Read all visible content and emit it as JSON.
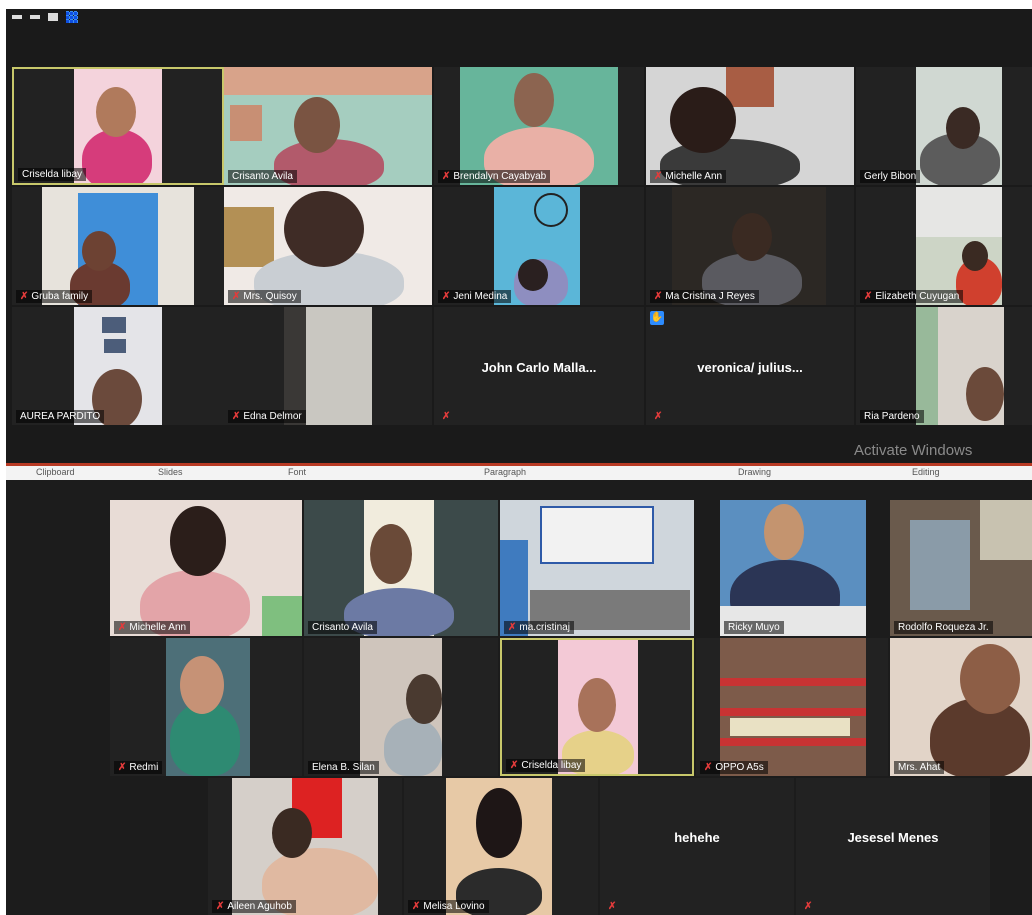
{
  "toolbar": {
    "icons": [
      "minimize-icon",
      "restore-icon",
      "speaker-view-icon",
      "gallery-view-icon"
    ]
  },
  "top_gallery": {
    "participants": [
      {
        "name": "Criselda libay",
        "muted": false,
        "active": true
      },
      {
        "name": "Crisanto Avila",
        "muted": false
      },
      {
        "name": "Brendalyn   Cayabyab",
        "muted": true
      },
      {
        "name": "Michelle Ann",
        "muted": true
      },
      {
        "name": "Gerly Bibon",
        "muted": false
      },
      {
        "name": "Gruba family",
        "muted": true
      },
      {
        "name": "Mrs. Quisoy",
        "muted": true
      },
      {
        "name": "Jeni Medina",
        "muted": true
      },
      {
        "name": "Ma Cristina J Reyes",
        "muted": true
      },
      {
        "name": "Elizabeth Cuyugan",
        "muted": true
      },
      {
        "name": "AUREA PARDITO",
        "muted": false
      },
      {
        "name": "Edna Delmor",
        "muted": true
      },
      {
        "name": "John Carlo Malla...",
        "muted": true,
        "video_off": true
      },
      {
        "name": "veronica/ julius...",
        "muted": true,
        "video_off": true,
        "hand_raised": true
      },
      {
        "name": "Ria Pardeno",
        "muted": false
      }
    ]
  },
  "ribbon": {
    "groups": [
      "Clipboard",
      "Slides",
      "Font",
      "Paragraph",
      "Drawing",
      "Editing"
    ]
  },
  "watermark": "Activate Windows",
  "bottom_gallery": {
    "participants": [
      {
        "name": "Michelle Ann",
        "muted": true
      },
      {
        "name": "Crisanto Avila",
        "muted": false
      },
      {
        "name": "ma.cristinaj",
        "muted": true
      },
      {
        "name": "Ricky Muyo",
        "muted": false
      },
      {
        "name": "Rodolfo Roqueza Jr.",
        "muted": false
      },
      {
        "name": "Redmi",
        "muted": true
      },
      {
        "name": "Elena B. Silan",
        "muted": false
      },
      {
        "name": "Criselda libay",
        "muted": true,
        "active": true
      },
      {
        "name": "OPPO A5s",
        "muted": true
      },
      {
        "name": "Mrs. Ahat",
        "muted": false
      },
      {
        "name": "Aileen Aguhob",
        "muted": true
      },
      {
        "name": "Melisa Lovino",
        "muted": true
      },
      {
        "name": "hehehe",
        "muted": true,
        "video_off": true
      },
      {
        "name": "Jesesel Menes",
        "muted": true,
        "video_off": true
      }
    ]
  }
}
